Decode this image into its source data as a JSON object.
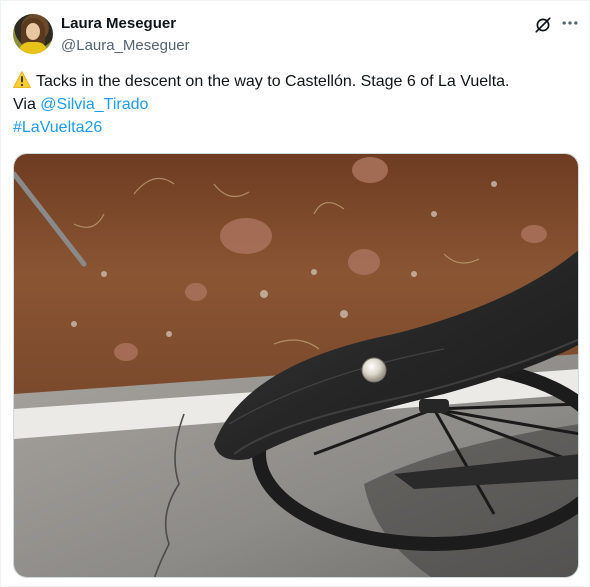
{
  "author": {
    "display_name": "Laura Meseguer",
    "handle": "@Laura_Meseguer",
    "avatar_icon": "profile-photo"
  },
  "header_actions": {
    "grok_icon": "grok-icon",
    "more_icon": "more-dots-icon"
  },
  "tweet": {
    "warning_icon": "warning-icon",
    "text_line1": "Tacks in the descent on the way to Castellón. Stage 6 of La Vuelta.",
    "text_via": "Via ",
    "mention": "@Silvia_Tirado",
    "hashtag": "#LaVuelta26"
  },
  "media": {
    "type": "photo"
  },
  "colors": {
    "link": "#1d9bf0",
    "primary_text": "#0f1419",
    "secondary_text": "#536471"
  }
}
